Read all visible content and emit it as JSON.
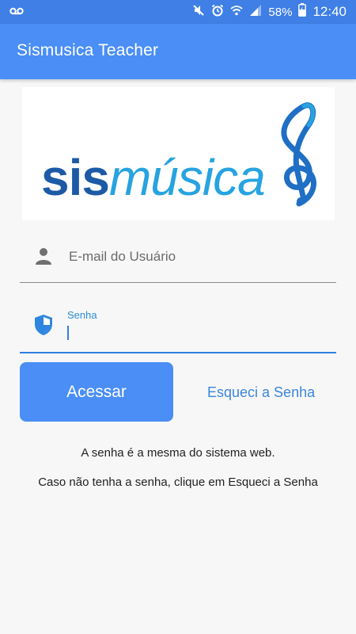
{
  "status_bar": {
    "battery_percent": "58%",
    "time": "12:40",
    "icons": [
      "voicemail-icon",
      "mute-icon",
      "alarm-icon",
      "wifi-icon",
      "signal-icon",
      "battery-icon"
    ]
  },
  "app_bar": {
    "title": "Sismusica Teacher"
  },
  "logo": {
    "sis": "sis",
    "musica": "música",
    "colors": {
      "sis": "#1c5aa6",
      "musica": "#27a3e0"
    }
  },
  "form": {
    "email_placeholder": "E-mail do Usuário",
    "email_value": "",
    "password_label": "Senha",
    "password_value": ""
  },
  "actions": {
    "login_label": "Acessar",
    "forgot_label": "Esqueci a Senha"
  },
  "info": {
    "line1": "A senha é a mesma do sistema web.",
    "line2": "Caso não tenha a senha, clique em Esqueci a Senha"
  },
  "colors": {
    "accent": "#4a8ef6",
    "status_bar": "#3f7fe6",
    "link": "#3d86db"
  }
}
